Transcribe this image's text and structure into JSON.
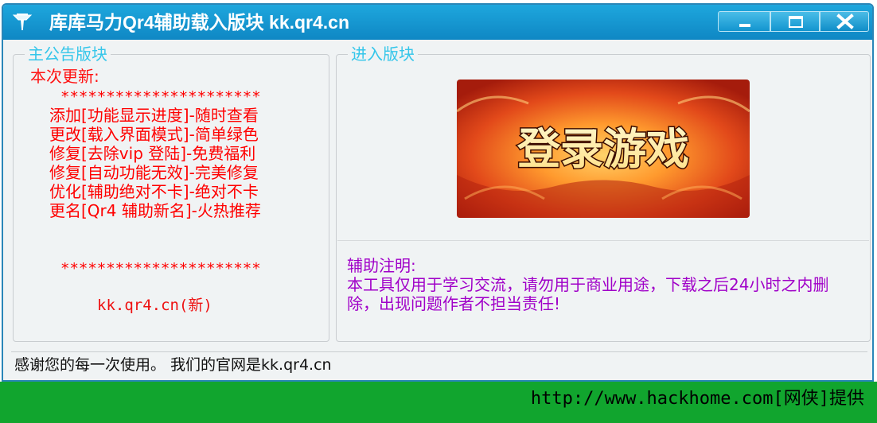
{
  "window": {
    "title": "库库马力Qr4辅助载入版块 kk.qr4.cn",
    "icon": "pin-icon",
    "controls": [
      "minimize-icon",
      "maximize-icon",
      "close-icon"
    ]
  },
  "notice": {
    "legend": "主公告版块",
    "heading": "本次更新:",
    "stars": "**********************",
    "lines": [
      "添加[功能显示进度]-随时查看",
      "更改[载入界面模式]-简单绿色",
      "修复[去除vip 登陆]-免费福利",
      "修复[自动功能无效]-完美修复",
      "优化[辅助绝对不卡]-绝对不卡",
      "更名[Qr4 辅助新名]-火热推荐"
    ],
    "site": "kk.qr4.cn(新)"
  },
  "entry": {
    "legend": "进入版块",
    "login_button": "登录游戏"
  },
  "note": {
    "title": "辅助注明:",
    "body": "本工具仅用于学习交流，请勿用于商业用途，下载之后24小时之内删除，出现问题作者不担当责任!"
  },
  "status": {
    "text": "感谢您的每一次使用。 我们的官网是kk.qr4.cn"
  },
  "footer": {
    "text": "http://www.hackhome.com[网侠]提供"
  },
  "colors": {
    "titlebar": "#1a9ad6",
    "legend": "#35c6ea",
    "notice_text": "#ff0000",
    "note_text": "#a000c8",
    "footer_bg": "#11a52e"
  }
}
